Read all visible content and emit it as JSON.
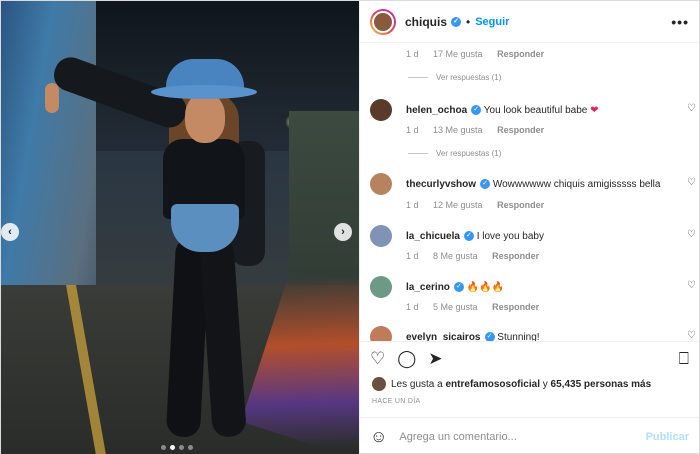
{
  "header": {
    "username": "chiquis",
    "follow_label": "Seguir",
    "separator": "•",
    "more": "•••"
  },
  "photo": {
    "dots_count": 4,
    "active_dot": 1
  },
  "comments": [
    {
      "likes": "17 Me gusta",
      "age": "1 d",
      "reply": "Responder",
      "view_replies": "Ver respuestas (1)"
    },
    {
      "username": "helen_ochoa",
      "text": "You look beautiful babe",
      "emoji": "❤",
      "age": "1 d",
      "likes": "13 Me gusta",
      "reply": "Responder",
      "view_replies": "Ver respuestas (1)",
      "avatar_color": "#5a3a2a"
    },
    {
      "username": "thecurlyvshow",
      "text": "Wowwwwww chiquis amigisssss bella",
      "age": "1 d",
      "likes": "12 Me gusta",
      "reply": "Responder",
      "avatar_color": "#b7835e"
    },
    {
      "username": "la_chicuela",
      "text": "I love you baby",
      "age": "1 d",
      "likes": "8 Me gusta",
      "reply": "Responder",
      "avatar_color": "#7f93b5"
    },
    {
      "username": "la_cerino",
      "text": "",
      "emoji": "🔥🔥🔥",
      "age": "1 d",
      "likes": "5 Me gusta",
      "reply": "Responder",
      "avatar_color": "#6c9a86"
    },
    {
      "username": "evelyn_sicairos",
      "text": "Stunning!",
      "avatar_color": "#c07b5a"
    }
  ],
  "likes": {
    "prefix": "Les gusta a",
    "user": "entrefamososoficial",
    "middle": "y",
    "count": "65,435 personas más"
  },
  "time_label": "HACE UN DÍA",
  "composer": {
    "placeholder": "Agrega un comentario...",
    "publish_label": "Publicar"
  },
  "icons": {
    "verified": "✓",
    "heart_outline": "♡",
    "heart": "♡",
    "comment": "◯",
    "share": "➤",
    "bookmark": "⎕",
    "smile": "☺",
    "prev": "‹",
    "next": "›"
  },
  "colors": {
    "accent": "#0095f6",
    "verified": "#3897f0",
    "publish_disabled": "#b2dffc",
    "muted": "#8e8e8e"
  }
}
